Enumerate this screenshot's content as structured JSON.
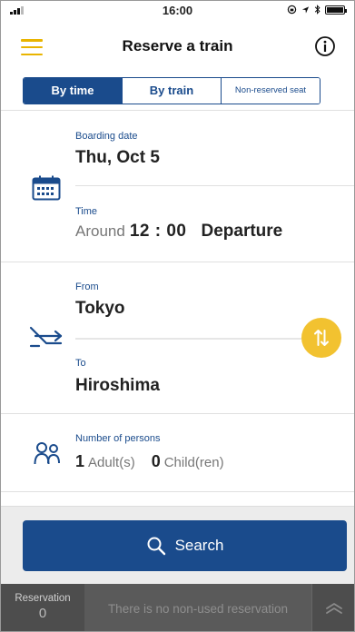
{
  "status_bar": {
    "time": "16:00"
  },
  "header": {
    "title": "Reserve a train"
  },
  "tabs": [
    {
      "label": "By time",
      "active": true
    },
    {
      "label": "By train",
      "active": false
    },
    {
      "label": "Non-reserved seat",
      "active": false
    }
  ],
  "boarding": {
    "label": "Boarding date",
    "value": "Thu, Oct 5"
  },
  "time": {
    "label": "Time",
    "prefix": "Around",
    "clock": "12 : 00",
    "mode": "Departure"
  },
  "route": {
    "from_label": "From",
    "from_value": "Tokyo",
    "to_label": "To",
    "to_value": "Hiroshima"
  },
  "persons": {
    "label": "Number of persons",
    "adults_count": "1",
    "adults_unit": "Adult(s)",
    "children_count": "0",
    "children_unit": "Child(ren)"
  },
  "search": {
    "label": "Search"
  },
  "bottom_bar": {
    "reservation_label": "Reservation",
    "reservation_count": "0",
    "message": "There is no non-used reservation"
  },
  "colors": {
    "primary": "#1a4b8c",
    "accent": "#f2c230",
    "menu": "#e9b400"
  }
}
